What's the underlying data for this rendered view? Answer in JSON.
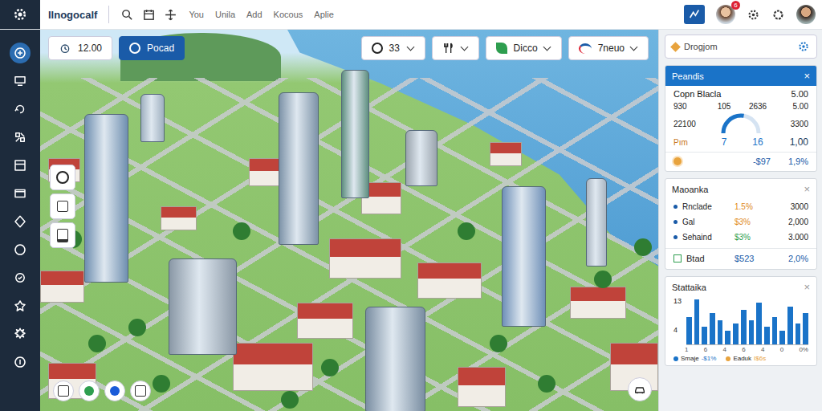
{
  "topbar": {
    "logo": "Ilnogocalf",
    "nav": [
      "You",
      "Unila",
      "Add",
      "Kocous",
      "Aplie"
    ],
    "notification_badge": "6"
  },
  "sidebar": {
    "items": [
      {
        "selected": true
      },
      {
        "selected": false
      },
      {
        "selected": false
      },
      {
        "selected": false
      },
      {
        "selected": false
      },
      {
        "selected": false
      },
      {
        "selected": false
      },
      {
        "selected": false
      },
      {
        "selected": false
      },
      {
        "selected": false
      },
      {
        "selected": false
      },
      {
        "selected": false
      }
    ]
  },
  "scene_toolbar": {
    "time": "12.00",
    "primary_button": "Pocad",
    "count_dropdown": "33",
    "mode_dropdown": "Dicco",
    "view_dropdown": "7neuo"
  },
  "side_panel": {
    "title": "Drogjom",
    "overview": {
      "title": "Peandis",
      "close": "×",
      "header_label": "Copn Blacla",
      "header_value": "5.00",
      "left": [
        "930",
        "22100",
        "Pım"
      ],
      "top": [
        "105",
        "2636"
      ],
      "bottom": [
        "7",
        "16"
      ],
      "right": [
        "5.00",
        "3300",
        "1,00"
      ],
      "gauge_level": 0.55,
      "footer_value": "-$97",
      "footer_percent": "1,9%"
    },
    "market": {
      "title": "Maoanka",
      "close": "×",
      "rows": [
        {
          "name": "Rnclade",
          "change": "1.5%",
          "value": "3000",
          "color": "#e08a1e"
        },
        {
          "name": "Gal",
          "change": "$3%",
          "value": "2,000",
          "color": "#e08a1e"
        },
        {
          "name": "Sehaind",
          "change": "$3%",
          "value": "3.000",
          "color": "#2e9e4f"
        }
      ],
      "footer_label": "Btad",
      "footer_value": "$523",
      "footer_percent": "2,0%"
    },
    "stats": {
      "title": "Stattaika",
      "close": "×",
      "y_ticks": [
        "13",
        "4"
      ],
      "x_ticks": [
        "1",
        "6",
        "4",
        "6",
        "4",
        "0",
        "0%"
      ],
      "values": [
        8,
        13,
        5,
        9,
        7,
        4,
        6,
        10,
        7,
        12,
        5,
        8,
        4,
        11,
        6,
        9
      ],
      "legend": [
        {
          "label": "Smaje",
          "value": "-$1%",
          "color": "#1a73c8"
        },
        {
          "label": "Eaduk",
          "value": "I$6s",
          "color": "#e8a33d"
        }
      ]
    }
  }
}
